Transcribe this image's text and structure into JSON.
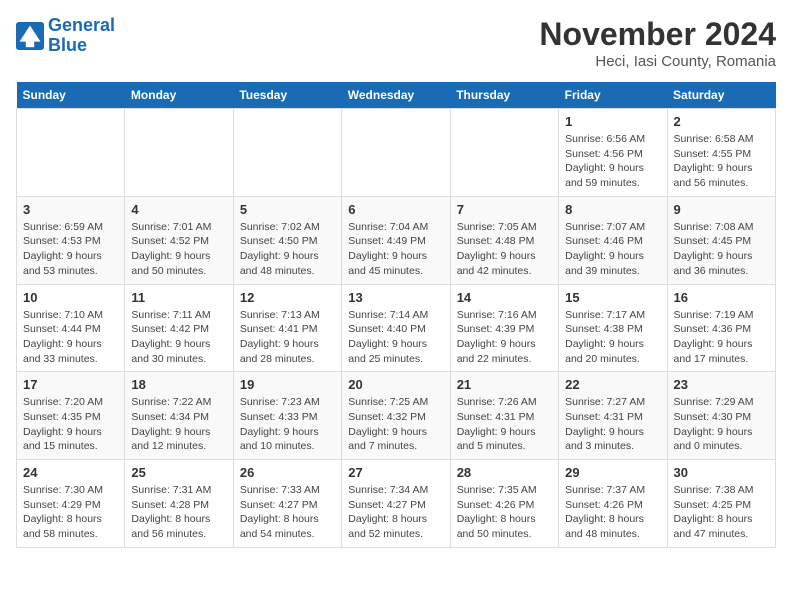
{
  "header": {
    "logo_general": "General",
    "logo_blue": "Blue",
    "title": "November 2024",
    "subtitle": "Heci, Iasi County, Romania"
  },
  "days_of_week": [
    "Sunday",
    "Monday",
    "Tuesday",
    "Wednesday",
    "Thursday",
    "Friday",
    "Saturday"
  ],
  "weeks": [
    [
      {
        "day": "",
        "info": ""
      },
      {
        "day": "",
        "info": ""
      },
      {
        "day": "",
        "info": ""
      },
      {
        "day": "",
        "info": ""
      },
      {
        "day": "",
        "info": ""
      },
      {
        "day": "1",
        "info": "Sunrise: 6:56 AM\nSunset: 4:56 PM\nDaylight: 9 hours and 59 minutes."
      },
      {
        "day": "2",
        "info": "Sunrise: 6:58 AM\nSunset: 4:55 PM\nDaylight: 9 hours and 56 minutes."
      }
    ],
    [
      {
        "day": "3",
        "info": "Sunrise: 6:59 AM\nSunset: 4:53 PM\nDaylight: 9 hours and 53 minutes."
      },
      {
        "day": "4",
        "info": "Sunrise: 7:01 AM\nSunset: 4:52 PM\nDaylight: 9 hours and 50 minutes."
      },
      {
        "day": "5",
        "info": "Sunrise: 7:02 AM\nSunset: 4:50 PM\nDaylight: 9 hours and 48 minutes."
      },
      {
        "day": "6",
        "info": "Sunrise: 7:04 AM\nSunset: 4:49 PM\nDaylight: 9 hours and 45 minutes."
      },
      {
        "day": "7",
        "info": "Sunrise: 7:05 AM\nSunset: 4:48 PM\nDaylight: 9 hours and 42 minutes."
      },
      {
        "day": "8",
        "info": "Sunrise: 7:07 AM\nSunset: 4:46 PM\nDaylight: 9 hours and 39 minutes."
      },
      {
        "day": "9",
        "info": "Sunrise: 7:08 AM\nSunset: 4:45 PM\nDaylight: 9 hours and 36 minutes."
      }
    ],
    [
      {
        "day": "10",
        "info": "Sunrise: 7:10 AM\nSunset: 4:44 PM\nDaylight: 9 hours and 33 minutes."
      },
      {
        "day": "11",
        "info": "Sunrise: 7:11 AM\nSunset: 4:42 PM\nDaylight: 9 hours and 30 minutes."
      },
      {
        "day": "12",
        "info": "Sunrise: 7:13 AM\nSunset: 4:41 PM\nDaylight: 9 hours and 28 minutes."
      },
      {
        "day": "13",
        "info": "Sunrise: 7:14 AM\nSunset: 4:40 PM\nDaylight: 9 hours and 25 minutes."
      },
      {
        "day": "14",
        "info": "Sunrise: 7:16 AM\nSunset: 4:39 PM\nDaylight: 9 hours and 22 minutes."
      },
      {
        "day": "15",
        "info": "Sunrise: 7:17 AM\nSunset: 4:38 PM\nDaylight: 9 hours and 20 minutes."
      },
      {
        "day": "16",
        "info": "Sunrise: 7:19 AM\nSunset: 4:36 PM\nDaylight: 9 hours and 17 minutes."
      }
    ],
    [
      {
        "day": "17",
        "info": "Sunrise: 7:20 AM\nSunset: 4:35 PM\nDaylight: 9 hours and 15 minutes."
      },
      {
        "day": "18",
        "info": "Sunrise: 7:22 AM\nSunset: 4:34 PM\nDaylight: 9 hours and 12 minutes."
      },
      {
        "day": "19",
        "info": "Sunrise: 7:23 AM\nSunset: 4:33 PM\nDaylight: 9 hours and 10 minutes."
      },
      {
        "day": "20",
        "info": "Sunrise: 7:25 AM\nSunset: 4:32 PM\nDaylight: 9 hours and 7 minutes."
      },
      {
        "day": "21",
        "info": "Sunrise: 7:26 AM\nSunset: 4:31 PM\nDaylight: 9 hours and 5 minutes."
      },
      {
        "day": "22",
        "info": "Sunrise: 7:27 AM\nSunset: 4:31 PM\nDaylight: 9 hours and 3 minutes."
      },
      {
        "day": "23",
        "info": "Sunrise: 7:29 AM\nSunset: 4:30 PM\nDaylight: 9 hours and 0 minutes."
      }
    ],
    [
      {
        "day": "24",
        "info": "Sunrise: 7:30 AM\nSunset: 4:29 PM\nDaylight: 8 hours and 58 minutes."
      },
      {
        "day": "25",
        "info": "Sunrise: 7:31 AM\nSunset: 4:28 PM\nDaylight: 8 hours and 56 minutes."
      },
      {
        "day": "26",
        "info": "Sunrise: 7:33 AM\nSunset: 4:27 PM\nDaylight: 8 hours and 54 minutes."
      },
      {
        "day": "27",
        "info": "Sunrise: 7:34 AM\nSunset: 4:27 PM\nDaylight: 8 hours and 52 minutes."
      },
      {
        "day": "28",
        "info": "Sunrise: 7:35 AM\nSunset: 4:26 PM\nDaylight: 8 hours and 50 minutes."
      },
      {
        "day": "29",
        "info": "Sunrise: 7:37 AM\nSunset: 4:26 PM\nDaylight: 8 hours and 48 minutes."
      },
      {
        "day": "30",
        "info": "Sunrise: 7:38 AM\nSunset: 4:25 PM\nDaylight: 8 hours and 47 minutes."
      }
    ]
  ]
}
